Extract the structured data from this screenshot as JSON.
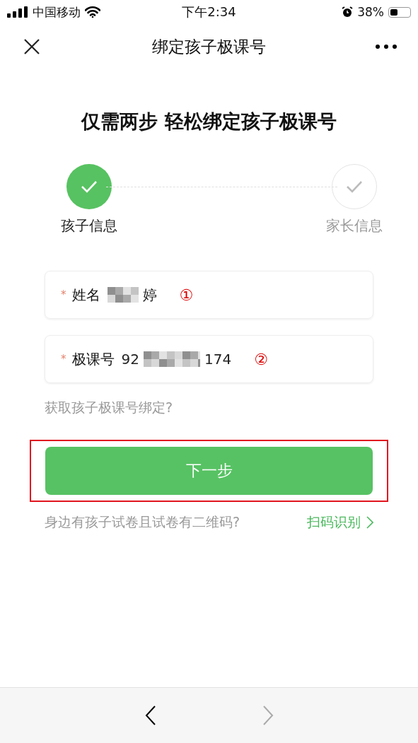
{
  "status_bar": {
    "carrier": "中国移动",
    "time": "下午2:34",
    "battery": "38%"
  },
  "nav": {
    "title": "绑定孩子极课号"
  },
  "headline": "仅需两步 轻松绑定孩子极课号",
  "steps": [
    {
      "label": "孩子信息",
      "done": true
    },
    {
      "label": "家长信息",
      "done": false
    }
  ],
  "fields": [
    {
      "label": "姓名",
      "required_mark": "*",
      "value_end": "婷",
      "redacted": true,
      "annotation": "①"
    },
    {
      "label": "极课号",
      "required_mark": "*",
      "value_start": "92",
      "value_end": "174",
      "redacted": true,
      "annotation": "②"
    }
  ],
  "help_link": "获取孩子极课号绑定?",
  "next_button": {
    "label": "下一步",
    "highlighted": true
  },
  "scan_hint": {
    "text": "身边有孩子试卷且试卷有二维码?",
    "link": "扫码识别"
  },
  "browser_bar": {
    "back_enabled": true,
    "forward_enabled": false
  }
}
